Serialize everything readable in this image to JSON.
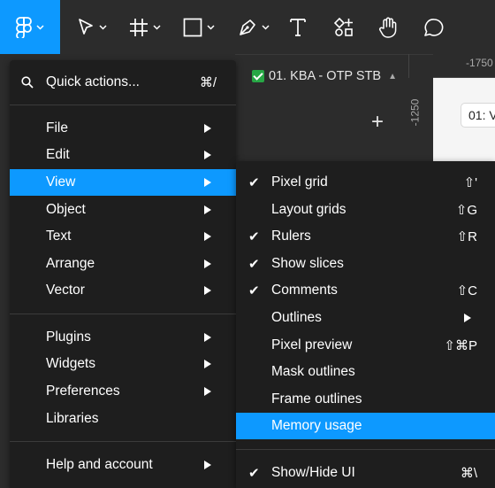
{
  "toolbar": {
    "tools": [
      {
        "icon": "figma-menu-icon",
        "active": true
      },
      {
        "icon": "move-tool-icon"
      },
      {
        "icon": "frame-tool-icon"
      },
      {
        "icon": "shape-tool-icon"
      },
      {
        "icon": "pen-tool-icon"
      },
      {
        "icon": "text-tool-icon"
      },
      {
        "icon": "resources-icon"
      },
      {
        "icon": "hand-tool-icon"
      },
      {
        "icon": "comment-tool-icon"
      }
    ],
    "accent": "#0d99ff"
  },
  "file_tab": {
    "label": "01. KBA - OTP STB"
  },
  "rulers": {
    "top": "-1750",
    "left": "-1250"
  },
  "frame_label": "01: V",
  "main_menu": {
    "quick_actions": {
      "label": "Quick actions...",
      "shortcut": "⌘/"
    },
    "group1": [
      "File",
      "Edit",
      "View",
      "Object",
      "Text",
      "Arrange",
      "Vector"
    ],
    "group2": [
      "Plugins",
      "Widgets",
      "Preferences",
      "Libraries"
    ],
    "help": "Help and account"
  },
  "view_menu": {
    "items": [
      {
        "label": "Pixel grid",
        "checked": true,
        "shortcut": "⇧'"
      },
      {
        "label": "Layout grids",
        "checked": false,
        "shortcut": "⇧G"
      },
      {
        "label": "Rulers",
        "checked": true,
        "shortcut": "⇧R"
      },
      {
        "label": "Show slices",
        "checked": true,
        "shortcut": ""
      },
      {
        "label": "Comments",
        "checked": true,
        "shortcut": "⇧C"
      },
      {
        "label": "Outlines",
        "checked": false,
        "shortcut": ""
      },
      {
        "label": "Pixel preview",
        "checked": false,
        "shortcut": "⇧⌘P"
      },
      {
        "label": "Mask outlines",
        "checked": false,
        "shortcut": ""
      },
      {
        "label": "Frame outlines",
        "checked": false,
        "shortcut": ""
      },
      {
        "label": "Memory usage",
        "checked": false,
        "shortcut": ""
      },
      {
        "label": "Show/Hide UI",
        "checked": true,
        "shortcut": "⌘\\"
      }
    ],
    "check_glyph": "✔"
  }
}
